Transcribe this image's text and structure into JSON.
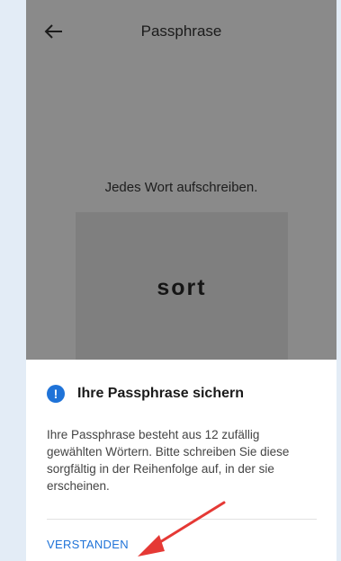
{
  "header": {
    "title": "Passphrase",
    "back_icon": "arrow-left-icon"
  },
  "word_display": {
    "instruction": "Jedes Wort aufschreiben.",
    "current_word": "sort"
  },
  "dialog": {
    "icon": "info-icon",
    "icon_glyph": "!",
    "title": "Ihre Passphrase sichern",
    "body": "Ihre Passphrase besteht aus 12 zufällig gewählten Wörtern. Bitte schreiben Sie diese sorgfältig in der Reihenfolge auf, in der sie erscheinen.",
    "confirm_label": "VERSTANDEN"
  },
  "colors": {
    "accent": "#1f73d8",
    "overlay": "#8a8a8a",
    "annotation": "#e53935"
  }
}
